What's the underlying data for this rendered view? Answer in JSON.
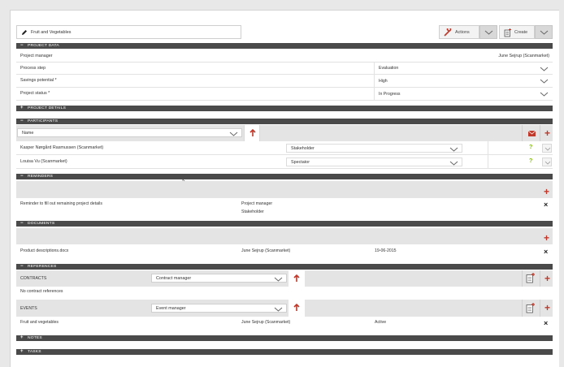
{
  "toolbar": {
    "title": "Fruit and Vegetables",
    "actions_label": "Actions",
    "create_label": "Create"
  },
  "sections": {
    "project_data": "PROJECT DATA",
    "project_details": "PROJECT DETAILS",
    "participants": "PARTICIPANTS",
    "reminders": "REMINDERS",
    "documents": "DOCUMENTS",
    "references": "REFERENCES",
    "notes": "NOTES",
    "tasks": "TASKS"
  },
  "project_data": {
    "manager_label": "Project manager",
    "manager_value": "June Sejrup (Scanmarket)",
    "process_label": "Process step",
    "process_value": "Evaluation",
    "savings_label": "Savings potential *",
    "savings_value": "High",
    "status_label": "Project status *",
    "status_value": "In Progress"
  },
  "participants": {
    "sort_value": "Name",
    "rows": [
      {
        "name": "Kasper Nørgård Rasmussen (Scanmarket)",
        "role": "Stakeholder",
        "flag": "?"
      },
      {
        "name": "Louisa Vu (Scanmarket)",
        "role": "Spectator",
        "flag": "?"
      }
    ]
  },
  "reminders": {
    "item": "Reminder to fill out remaining project details",
    "recipients": [
      "Project manager",
      "Stakeholder"
    ]
  },
  "documents": {
    "file": "Product descriptions.docx",
    "owner": "June Sejrup (Scanmarket)",
    "date": "19-06-2015"
  },
  "references": {
    "contracts_label": "CONTRACTS",
    "contracts_select": "Contract manager",
    "contracts_empty": "No contract references",
    "events_label": "EVENTS",
    "events_select": "Event manager",
    "event_name": "Fruit and vegetables",
    "event_owner": "June Sejrup (Scanmarket)",
    "event_status": "Active"
  },
  "symbols": {
    "minus": "−",
    "plus": "+",
    "add": "+",
    "close": "×"
  },
  "colors": {
    "accent": "#c0392b",
    "header": "#4a4a4a",
    "check": "#7fb800"
  }
}
